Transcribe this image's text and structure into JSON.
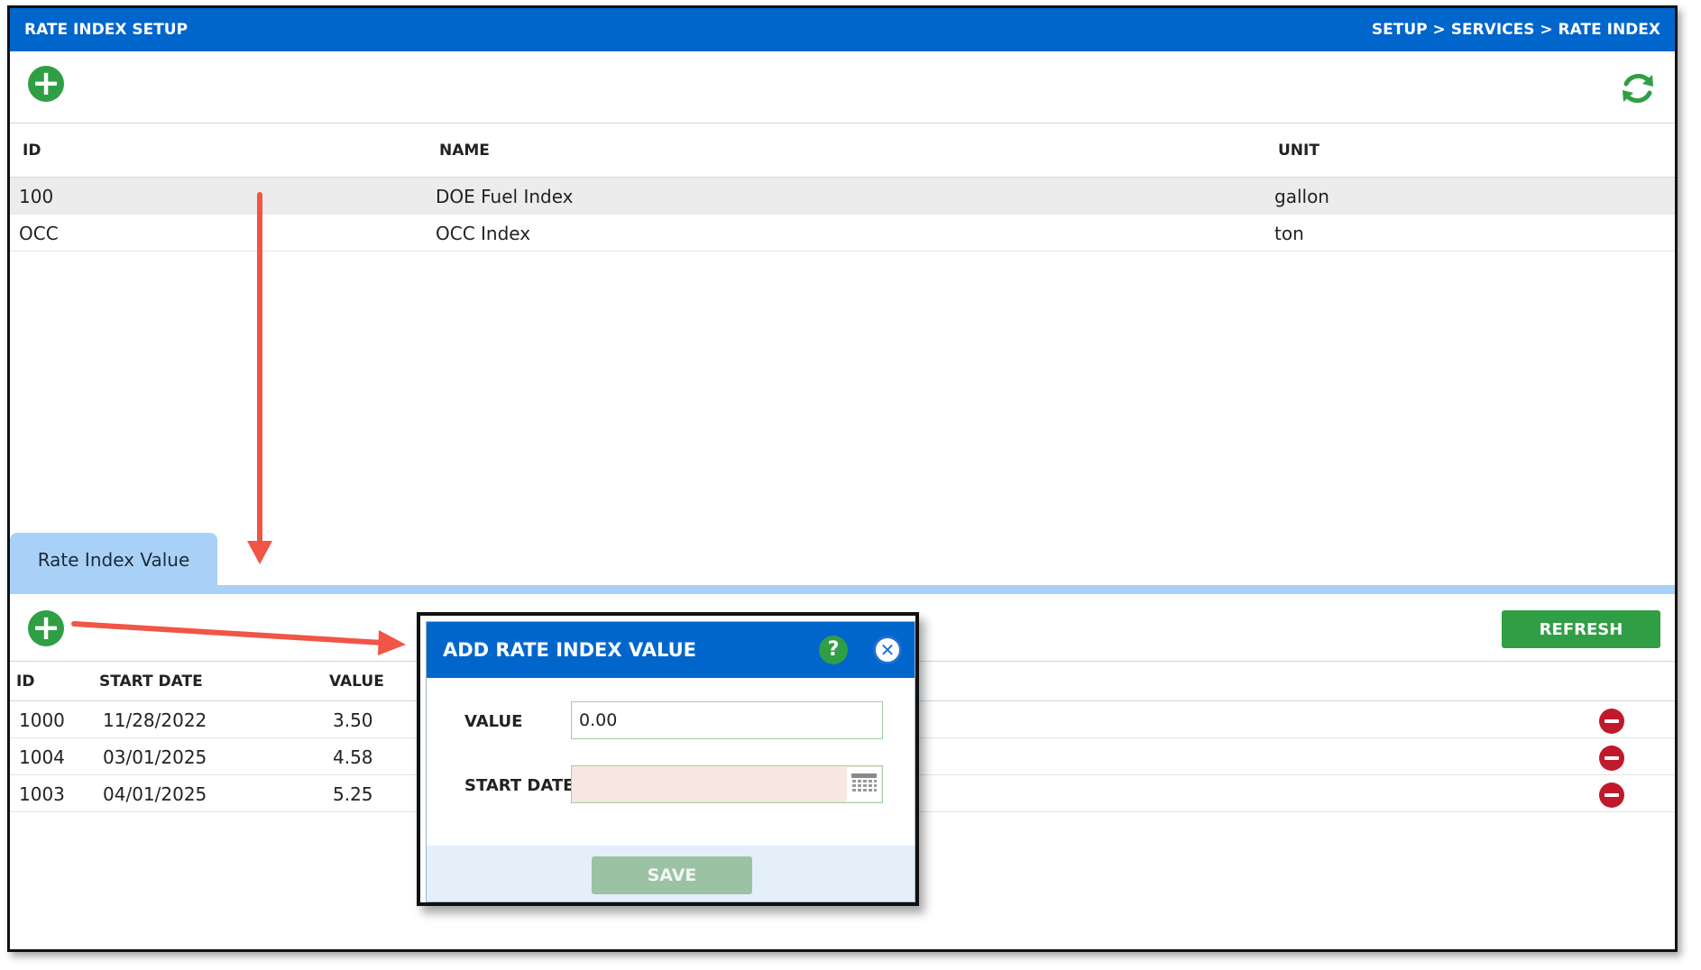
{
  "header": {
    "title": "RATE INDEX SETUP",
    "breadcrumb": "SETUP > SERVICES > RATE INDEX"
  },
  "toolbar": {
    "add_icon": "plus-circle-icon",
    "refresh_icon": "refresh-icon"
  },
  "main_table": {
    "columns": [
      "ID",
      "NAME",
      "UNIT"
    ],
    "rows": [
      {
        "id": "100",
        "name": "DOE Fuel Index",
        "unit": "gallon"
      },
      {
        "id": "OCC",
        "name": "OCC Index",
        "unit": "ton"
      }
    ]
  },
  "tab": {
    "label": "Rate Index Value"
  },
  "sub_toolbar": {
    "refresh_label": "REFRESH"
  },
  "sub_table": {
    "columns": [
      "ID",
      "START DATE",
      "VALUE"
    ],
    "rows": [
      {
        "id": "1000",
        "start_date": "11/28/2022",
        "value": "3.50"
      },
      {
        "id": "1004",
        "start_date": "03/01/2025",
        "value": "4.58"
      },
      {
        "id": "1003",
        "start_date": "04/01/2025",
        "value": "5.25"
      }
    ]
  },
  "modal": {
    "title": "ADD RATE INDEX VALUE",
    "help_label": "?",
    "close_label": "✕",
    "value_label": "VALUE",
    "value_input": "0.00",
    "start_date_label": "START DATE",
    "start_date_input": "",
    "save_label": "SAVE"
  },
  "colors": {
    "header_blue": "#0066cc",
    "green": "#2f9e44",
    "tab_blue": "#a9d1f7",
    "delete_red": "#c0192b",
    "annotation_arrow": "#f05545"
  }
}
